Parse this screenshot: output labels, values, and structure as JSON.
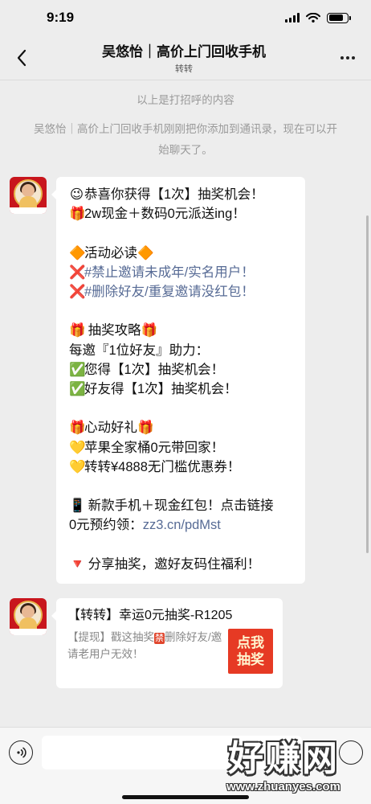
{
  "status_bar": {
    "time": "9:19",
    "battery_level": 0.8
  },
  "header": {
    "title": "吴悠怡｜高价上门回收手机",
    "subtitle": "转转"
  },
  "system_messages": [
    "以上是打招呼的内容",
    "吴悠怡｜高价上门回收手机刚刚把你添加到通讯录，现在可以开始聊天了。"
  ],
  "messages": [
    {
      "type": "text",
      "lines": [
        {
          "emoji": "😉",
          "text": "恭喜你获得【1次】抽奖机会！"
        },
        {
          "emoji": "🎁",
          "text": "2w现金＋数码0元派送ing！"
        },
        {
          "blank": true
        },
        {
          "emoji": "🔶",
          "text": "活动必读",
          "emoji_after": "🔶"
        },
        {
          "emoji": "❌",
          "text": "#禁止邀请未成年/实名用户！",
          "style": "hashtag"
        },
        {
          "emoji": "❌",
          "text": "#删除好友/重复邀请没红包！",
          "style": "hashtag"
        },
        {
          "blank": true
        },
        {
          "emoji": "🎁",
          "text": " 抽奖攻略",
          "emoji_after": "🎁"
        },
        {
          "text": "每邀『1位好友』助力："
        },
        {
          "emoji": "✅",
          "text": "您得【1次】抽奖机会！"
        },
        {
          "emoji": "✅",
          "text": "好友得【1次】抽奖机会！"
        },
        {
          "blank": true
        },
        {
          "emoji": "🎁",
          "text": "心动好礼",
          "emoji_after": "🎁"
        },
        {
          "emoji": "💛",
          "text": "苹果全家桶0元带回家！"
        },
        {
          "emoji": "💛",
          "text": "转转¥4888无门槛优惠券！"
        },
        {
          "blank": true
        },
        {
          "emoji": "📱",
          "text": " 新款手机＋现金红包！点击链接"
        },
        {
          "text": "0元预约领：",
          "link": "zz3.cn/pdMst"
        },
        {
          "blank": true
        },
        {
          "emoji": "🔻",
          "text": " 分享抽奖，邀好友码住福利！"
        }
      ]
    },
    {
      "type": "link_card",
      "title": "【转转】幸运0元抽奖-R1205",
      "desc_before": "【提现】戳这抽奖",
      "badge": "禁",
      "desc_after": "删除好友/邀请老用户无效！",
      "thumb_line1": "点我",
      "thumb_line2": "抽奖"
    }
  ],
  "input_bar": {
    "placeholder": ""
  },
  "watermark": {
    "logo": "好赚网",
    "url": "www.zhuanyes.com"
  },
  "colors": {
    "link": "#576b95",
    "background": "#ededed",
    "thumb_red": "#e63a24"
  }
}
